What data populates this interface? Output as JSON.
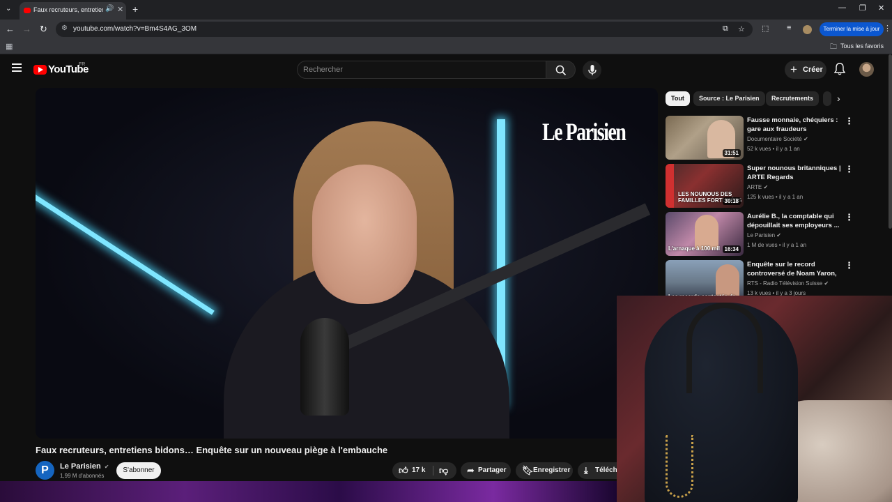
{
  "browser": {
    "tab_title": "Faux recruteurs, entretiens b",
    "url": "youtube.com/watch?v=Bm4S4AG_3OM",
    "update_button": "Terminer la mise à jour",
    "bookmarks_folder": "Tous les favoris"
  },
  "header": {
    "logo_word": "YouTube",
    "country_code": "FR",
    "search_placeholder": "Rechercher",
    "create_label": "Créer"
  },
  "player": {
    "brand_watermark": "Le Parisien"
  },
  "video": {
    "title": "Faux recruteurs, entretiens bidons… Enquête sur un nouveau piège à l'embauche",
    "channel_initial": "P",
    "channel_name": "Le Parisien",
    "channel_verified_icon": "✔",
    "subscribers": "1,99 M d'abonnés",
    "subscribe_label": "S'abonner",
    "likes": "17 k",
    "share_label": "Partager",
    "save_label": "Enregistrer",
    "download_label": "Télécha"
  },
  "chips": [
    "Tout",
    "Source : Le Parisien",
    "Recrutements"
  ],
  "recommendations": [
    {
      "title": "Fausse monnaie, chéquiers : gare aux fraudeurs",
      "channel": "Documentaire Société",
      "meta": "52 k vues • il y a 1 an",
      "duration": "31:51",
      "overlay": ""
    },
    {
      "title": "Super nounous britanniques | ARTE Regards",
      "channel": "ARTE",
      "meta": "125 k vues • il y a 1 an",
      "duration": "30:18",
      "overlay": "LES NOUNOUS DES FAMILLES FORTUNÉES"
    },
    {
      "title": "Aurélie B., la comptable qui dépouillait ses employeurs ...",
      "channel": "Le Parisien",
      "meta": "1 M de vues • il y a 1 an",
      "duration": "16:34",
      "overlay": "L'arnaque à 100 mil"
    },
    {
      "title": "Enquête sur le record controversé de Noam Yaron, ...",
      "channel": "RTS - Radio Télévision Suisse",
      "meta": "13 k vues • il y a 3 jours",
      "duration": "",
      "overlay": "Les records contestés de"
    }
  ],
  "colors": {
    "brand_red": "#ff0000",
    "bg": "#0f0f0f",
    "accent_blue": "#0b57d0"
  }
}
